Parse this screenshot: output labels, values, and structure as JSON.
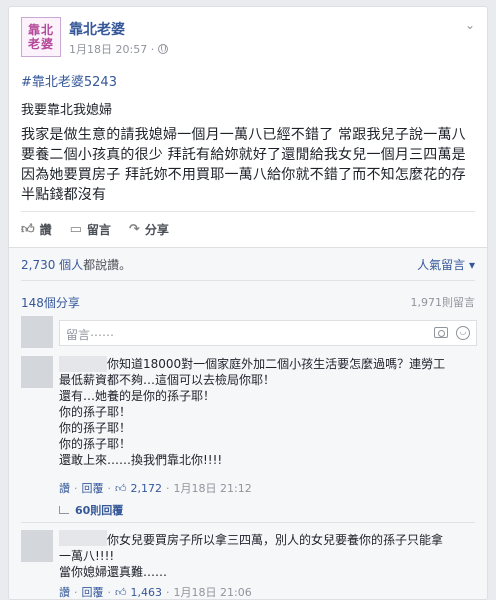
{
  "post": {
    "page_name": "靠北老婆",
    "avatar_text_line1": "靠北",
    "avatar_text_line2": "老婆",
    "time": "1月18日 20:57 ·",
    "hashtag": "#靠北老婆5243",
    "headline": "我要靠北我媳婦",
    "body": "我家是做生意的請我媳婦一個月一萬八已經不錯了 常跟我兒子說一萬八要養二個小孩真的很少 拜託有給妳就好了還閒給我女兒一個月三四萬是因為她要買房子 拜託妳不用買耶一萬八給你就不錯了而不知怎麼花的存半點錢都沒有"
  },
  "actions": {
    "like": "讚",
    "comment": "留言",
    "share": "分享"
  },
  "stats": {
    "likes_count": "2,730 個人",
    "likes_suffix": "都說讚。",
    "sort_label": "人氣留言",
    "shares": "148個分享",
    "comments_count": "1,971則留言"
  },
  "composer": {
    "placeholder": "留言⋯⋯"
  },
  "comments": [
    {
      "text": "你知道18000對一個家庭外加二個小孩生活要怎麼過嗎？連勞工最低薪資都不夠…這個可以去檢局你耶！還有…她養的是你的孫子耶！你的孫子耶！你的孫子耶！你的孫子耶！還敢上來……換我們靠北你!!!!",
      "lines": [
        "你知道18000對一個家庭外加二個小孩生活要怎麼過嗎？連勞工",
        "最低薪資都不夠…這個可以去檢局你耶！",
        "還有…她養的是你的孫子耶！",
        "你的孫子耶！",
        "你的孫子耶！",
        "你的孫子耶！",
        "還敢上來……換我們靠北你!!!!"
      ],
      "like": "讚",
      "reply": "回覆",
      "likes": "2,172",
      "time": "1月18日 21:12",
      "replies": "60則回覆"
    },
    {
      "lines": [
        "你女兒要買房子所以拿三四萬，別人的女兒要養你的孫子只能拿",
        "一萬八!!!!",
        "當你媳婦還真難……"
      ],
      "like": "讚",
      "reply": "回覆",
      "likes": "1,463",
      "time": "1月18日 21:06"
    }
  ],
  "colors": {
    "link": "#365899",
    "meta": "#90949c",
    "background": "#e9ebee"
  }
}
